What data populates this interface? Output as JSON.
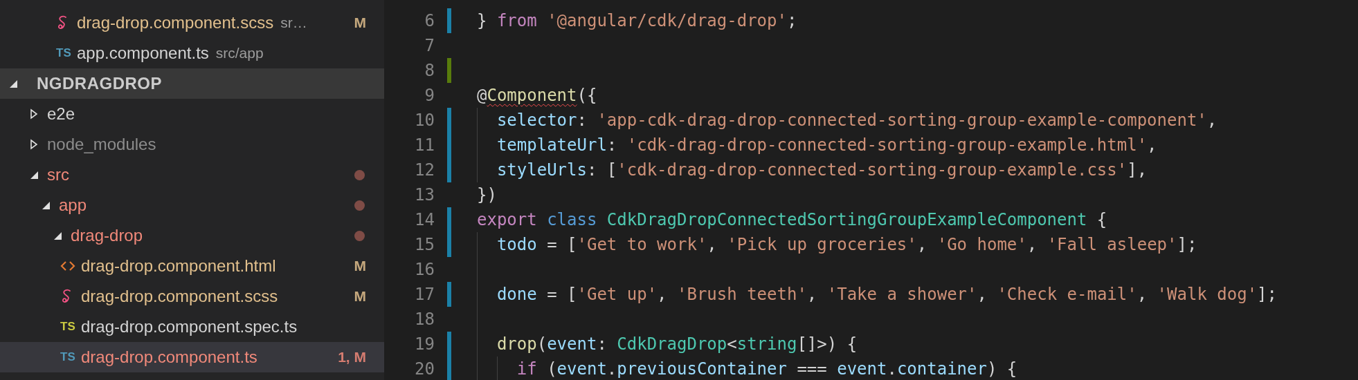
{
  "open_editors": [
    {
      "icon": {
        "kind": "sass"
      },
      "name": "drag-drop.component.scss",
      "color": "#e2c08d",
      "path": "sr…",
      "badge": "M",
      "selected": false
    },
    {
      "icon": {
        "kind": "letters",
        "text": "TS",
        "color": "#519aba"
      },
      "name": "app.component.ts",
      "color": "#d4d4d4",
      "path": "src/app",
      "selected": false
    }
  ],
  "explorer": {
    "title": "NGDRAGDROP",
    "expanded": true,
    "items": [
      {
        "kind": "folder",
        "name": "e2e",
        "color": "#d4d4d4",
        "expanded": false,
        "changed": false,
        "selected": false
      },
      {
        "kind": "folder",
        "name": "node_modules",
        "color": "#8c8c8c",
        "expanded": false,
        "changed": false,
        "selected": false
      },
      {
        "kind": "folder",
        "name": "src",
        "color": "#f1897a",
        "expanded": true,
        "changed": true,
        "selected": false,
        "children": [
          {
            "kind": "folder",
            "name": "app",
            "color": "#f1897a",
            "expanded": true,
            "changed": true,
            "selected": false,
            "children": [
              {
                "kind": "folder",
                "name": "drag-drop",
                "color": "#f1897a",
                "expanded": true,
                "changed": true,
                "selected": false,
                "children": [
                  {
                    "kind": "file",
                    "icon": {
                      "kind": "html"
                    },
                    "name": "drag-drop.component.html",
                    "color": "#e2c08d",
                    "badge": "M",
                    "selected": false
                  },
                  {
                    "kind": "file",
                    "icon": {
                      "kind": "sass"
                    },
                    "name": "drag-drop.component.scss",
                    "color": "#e2c08d",
                    "badge": "M",
                    "selected": false
                  },
                  {
                    "kind": "file",
                    "icon": {
                      "kind": "letters",
                      "text": "TS",
                      "color": "#cbcb41"
                    },
                    "name": "drag-drop.component.spec.ts",
                    "color": "#d4d4d4",
                    "selected": false
                  },
                  {
                    "kind": "file",
                    "icon": {
                      "kind": "letters",
                      "text": "TS",
                      "color": "#519aba"
                    },
                    "name": "drag-drop.component.ts",
                    "color": "#f1897a",
                    "badge": "1, M",
                    "selected": true
                  }
                ]
              }
            ]
          }
        ]
      }
    ]
  },
  "editor": {
    "lines": [
      {
        "number": "6",
        "kind": "modified",
        "tokens": [
          {
            "kind": "plain",
            "text": "}"
          },
          {
            "kind": "keyword",
            "text": " from"
          },
          {
            "kind": "string",
            "text": " '@angular/cdk/drag-drop'"
          },
          {
            "kind": "plain",
            "text": ";"
          }
        ]
      },
      {
        "number": "7",
        "kind": "unchanged"
      },
      {
        "number": "8",
        "kind": "added"
      },
      {
        "number": "9",
        "kind": "unchanged",
        "tokens": [
          {
            "kind": "plain",
            "text": "@"
          },
          {
            "kind": "function",
            "text": "Component",
            "error": true
          },
          {
            "kind": "plain",
            "text": "({"
          }
        ],
        "children": [
          {
            "number": "10",
            "kind": "modified",
            "tokens": [
              {
                "kind": "property",
                "text": "selector"
              },
              {
                "kind": "plain",
                "text": ":"
              },
              {
                "kind": "string",
                "text": " 'app-cdk-drag-drop-connected-sorting-group-example-component'"
              },
              {
                "kind": "plain",
                "text": ","
              }
            ]
          },
          {
            "number": "11",
            "kind": "modified",
            "tokens": [
              {
                "kind": "property",
                "text": "templateUrl"
              },
              {
                "kind": "plain",
                "text": ":"
              },
              {
                "kind": "string",
                "text": " 'cdk-drag-drop-connected-sorting-group-example.html'"
              },
              {
                "kind": "plain",
                "text": ","
              }
            ]
          },
          {
            "number": "12",
            "kind": "modified",
            "tokens": [
              {
                "kind": "property",
                "text": "styleUrls"
              },
              {
                "kind": "plain",
                "text": ": ["
              },
              {
                "kind": "string",
                "text": "'cdk-drag-drop-connected-sorting-group-example.css'"
              },
              {
                "kind": "plain",
                "text": "],"
              }
            ]
          }
        ]
      },
      {
        "number": "13",
        "kind": "unchanged",
        "tokens": [
          {
            "kind": "plain",
            "text": "})"
          }
        ]
      },
      {
        "number": "14",
        "kind": "modified",
        "tokens": [
          {
            "kind": "keyword",
            "text": "export"
          },
          {
            "kind": "storage",
            "text": " class"
          },
          {
            "kind": "type",
            "text": " CdkDragDropConnectedSortingGroupExampleComponent"
          },
          {
            "kind": "plain",
            "text": " {"
          }
        ],
        "children": [
          {
            "number": "15",
            "kind": "modified",
            "tokens": [
              {
                "kind": "property",
                "text": "todo"
              },
              {
                "kind": "plain",
                "text": " = ["
              },
              {
                "kind": "string",
                "text": "'Get to work'"
              },
              {
                "kind": "plain",
                "text": ", "
              },
              {
                "kind": "string",
                "text": "'Pick up groceries'"
              },
              {
                "kind": "plain",
                "text": ", "
              },
              {
                "kind": "string",
                "text": "'Go home'"
              },
              {
                "kind": "plain",
                "text": ", "
              },
              {
                "kind": "string",
                "text": "'Fall asleep'"
              },
              {
                "kind": "plain",
                "text": "];"
              }
            ]
          },
          {
            "number": "16",
            "kind": "unchanged"
          },
          {
            "number": "17",
            "kind": "modified",
            "tokens": [
              {
                "kind": "property",
                "text": "done"
              },
              {
                "kind": "plain",
                "text": " = ["
              },
              {
                "kind": "string",
                "text": "'Get up'"
              },
              {
                "kind": "plain",
                "text": ", "
              },
              {
                "kind": "string",
                "text": "'Brush teeth'"
              },
              {
                "kind": "plain",
                "text": ", "
              },
              {
                "kind": "string",
                "text": "'Take a shower'"
              },
              {
                "kind": "plain",
                "text": ", "
              },
              {
                "kind": "string",
                "text": "'Check e-mail'"
              },
              {
                "kind": "plain",
                "text": ", "
              },
              {
                "kind": "string",
                "text": "'Walk dog'"
              },
              {
                "kind": "plain",
                "text": "];"
              }
            ]
          },
          {
            "number": "18",
            "kind": "unchanged"
          },
          {
            "number": "19",
            "kind": "modified",
            "tokens": [
              {
                "kind": "function",
                "text": "drop"
              },
              {
                "kind": "plain",
                "text": "("
              },
              {
                "kind": "property",
                "text": "event"
              },
              {
                "kind": "plain",
                "text": ":"
              },
              {
                "kind": "type",
                "text": " CdkDragDrop"
              },
              {
                "kind": "plain",
                "text": "<"
              },
              {
                "kind": "type",
                "text": "string"
              },
              {
                "kind": "plain",
                "text": "[]>) {"
              }
            ],
            "children": [
              {
                "number": "20",
                "kind": "modified",
                "tokens": [
                  {
                    "kind": "keyword",
                    "text": "if"
                  },
                  {
                    "kind": "plain",
                    "text": " ("
                  },
                  {
                    "kind": "property",
                    "text": "event"
                  },
                  {
                    "kind": "plain",
                    "text": "."
                  },
                  {
                    "kind": "property",
                    "text": "previousContainer"
                  },
                  {
                    "kind": "plain",
                    "text": " ==="
                  },
                  {
                    "kind": "property",
                    "text": " event"
                  },
                  {
                    "kind": "plain",
                    "text": "."
                  },
                  {
                    "kind": "property",
                    "text": "container"
                  },
                  {
                    "kind": "plain",
                    "text": ") {"
                  }
                ]
              }
            ]
          }
        ]
      }
    ]
  }
}
